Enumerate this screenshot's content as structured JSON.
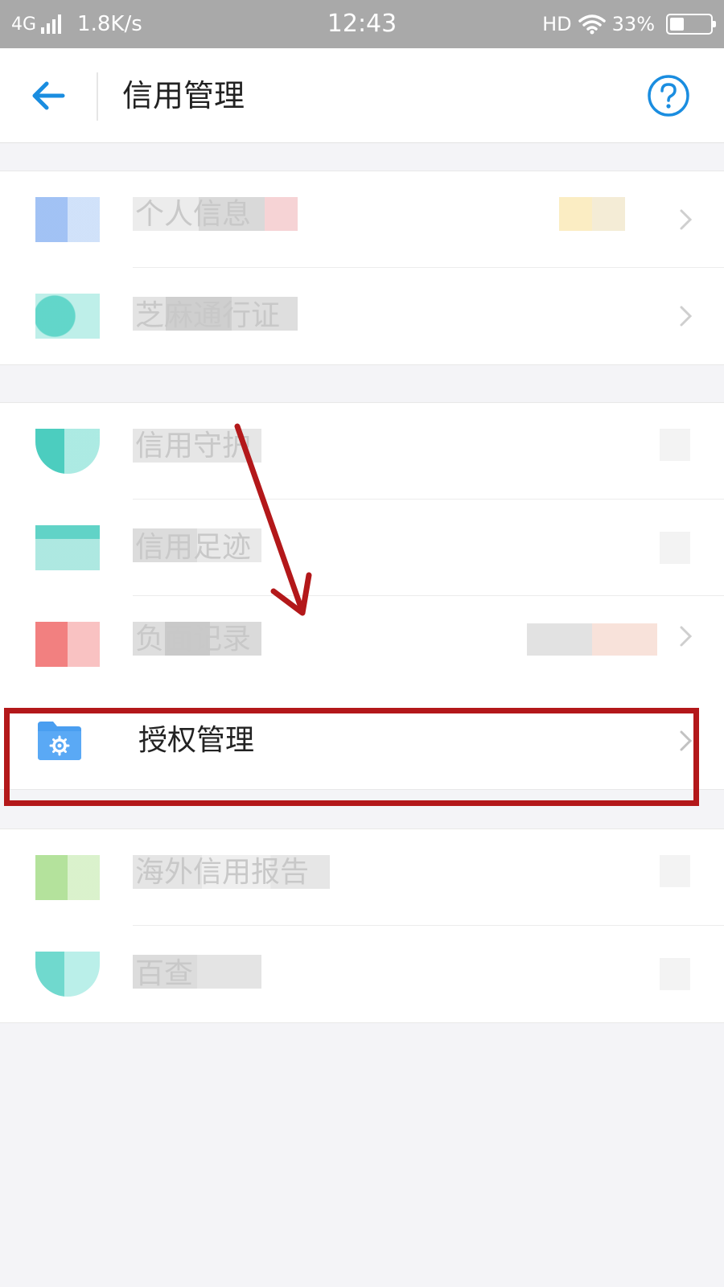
{
  "status_bar": {
    "network": "4G",
    "speed": "1.8K/s",
    "time": "12:43",
    "hd": "HD",
    "battery": "33%",
    "battery_level": 0.33
  },
  "header": {
    "title": "信用管理",
    "back_icon": "arrow-left-icon",
    "help_icon": "question-circle-icon",
    "accent_color": "#1a8de0"
  },
  "sections": [
    {
      "items": [
        {
          "label": "个人信息",
          "icon": "profile-card-icon",
          "blurred": true
        },
        {
          "label": "芝麻通行证",
          "icon": "badge-icon",
          "blurred": true
        }
      ]
    },
    {
      "items": [
        {
          "label": "信用守护",
          "icon": "shield-user-icon",
          "blurred": true
        },
        {
          "label": "信用足迹",
          "icon": "calendar-icon",
          "blurred": true
        },
        {
          "label": "负面记录",
          "icon": "document-x-icon",
          "blurred": true
        },
        {
          "label": "授权管理",
          "icon": "folder-gear-icon",
          "blurred": false,
          "highlighted": true
        }
      ]
    },
    {
      "items": [
        {
          "label": "海外信用报告",
          "icon": "green-report-icon",
          "blurred": true
        },
        {
          "label": "百查",
          "icon": "teal-check-icon",
          "blurred": true
        }
      ]
    }
  ],
  "annotation": {
    "color": "#b3181a"
  }
}
